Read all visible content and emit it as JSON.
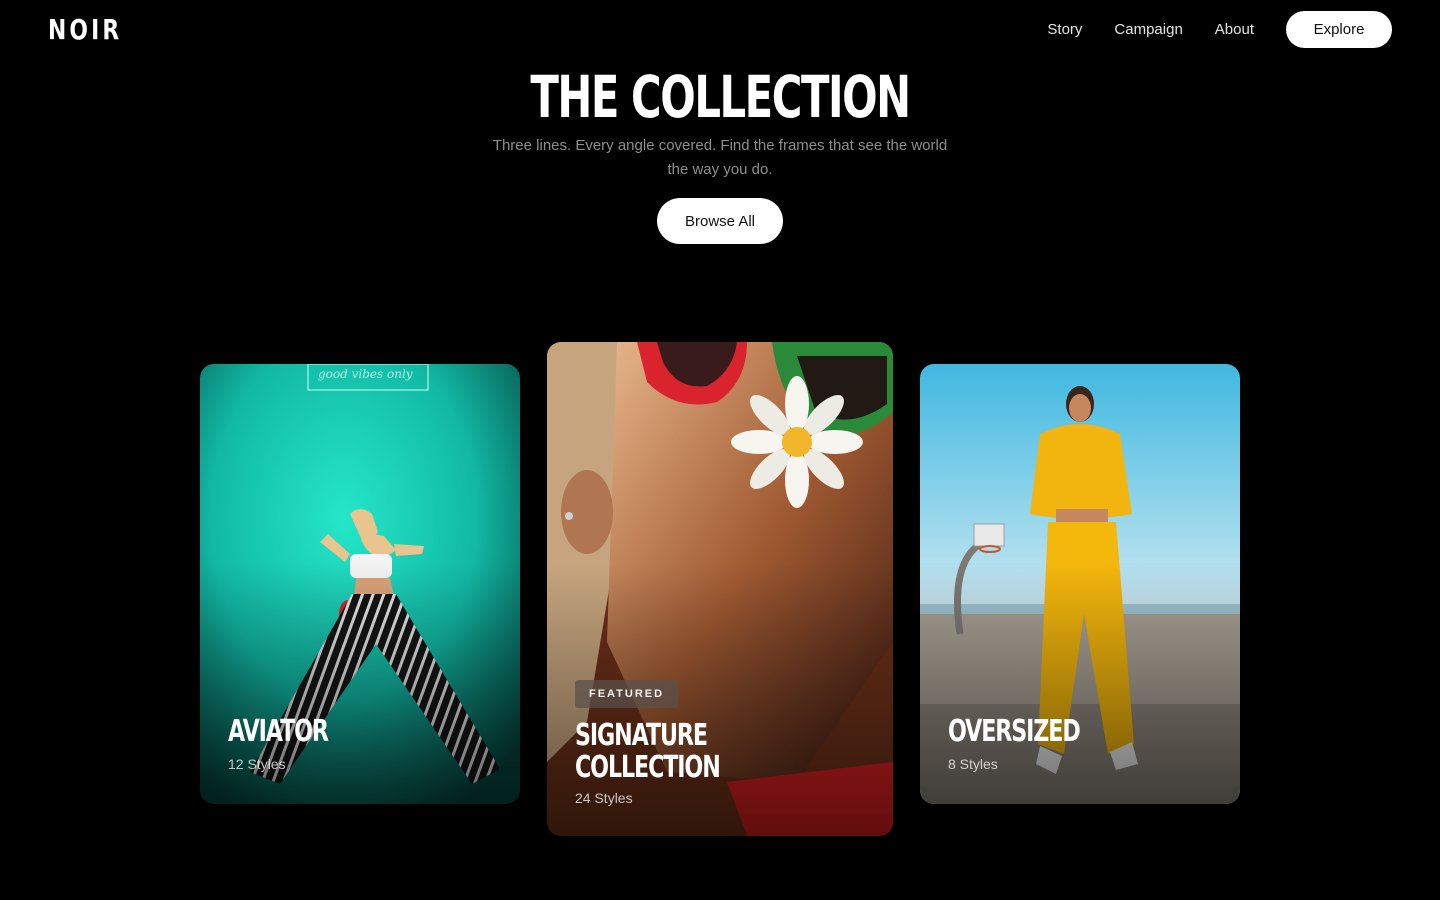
{
  "brand": {
    "logo": "NOIR"
  },
  "nav": {
    "links": [
      "Story",
      "Campaign",
      "About"
    ],
    "cta_label": "Explore"
  },
  "hero": {
    "title": "THE COLLECTION",
    "subtitle": "Three lines. Every angle covered. Find the frames that see the world the way you do.",
    "cta_label": "Browse All"
  },
  "collections": [
    {
      "name": "AVIATOR",
      "count": "12 Styles",
      "image": "woman-teal-wall-photo"
    },
    {
      "badge": "FEATURED",
      "name": "SIGNATURE\nCOLLECTION",
      "count": "24 Styles",
      "image": "woman-sunglasses-daisy-photo"
    },
    {
      "name": "OVERSIZED",
      "count": "8 Styles",
      "image": "woman-yellow-tracksuit-court-photo"
    }
  ],
  "colors": {
    "background": "#000000",
    "button_bg": "#ffffff",
    "button_text": "#111111",
    "muted_text": "#8e8e8e"
  }
}
